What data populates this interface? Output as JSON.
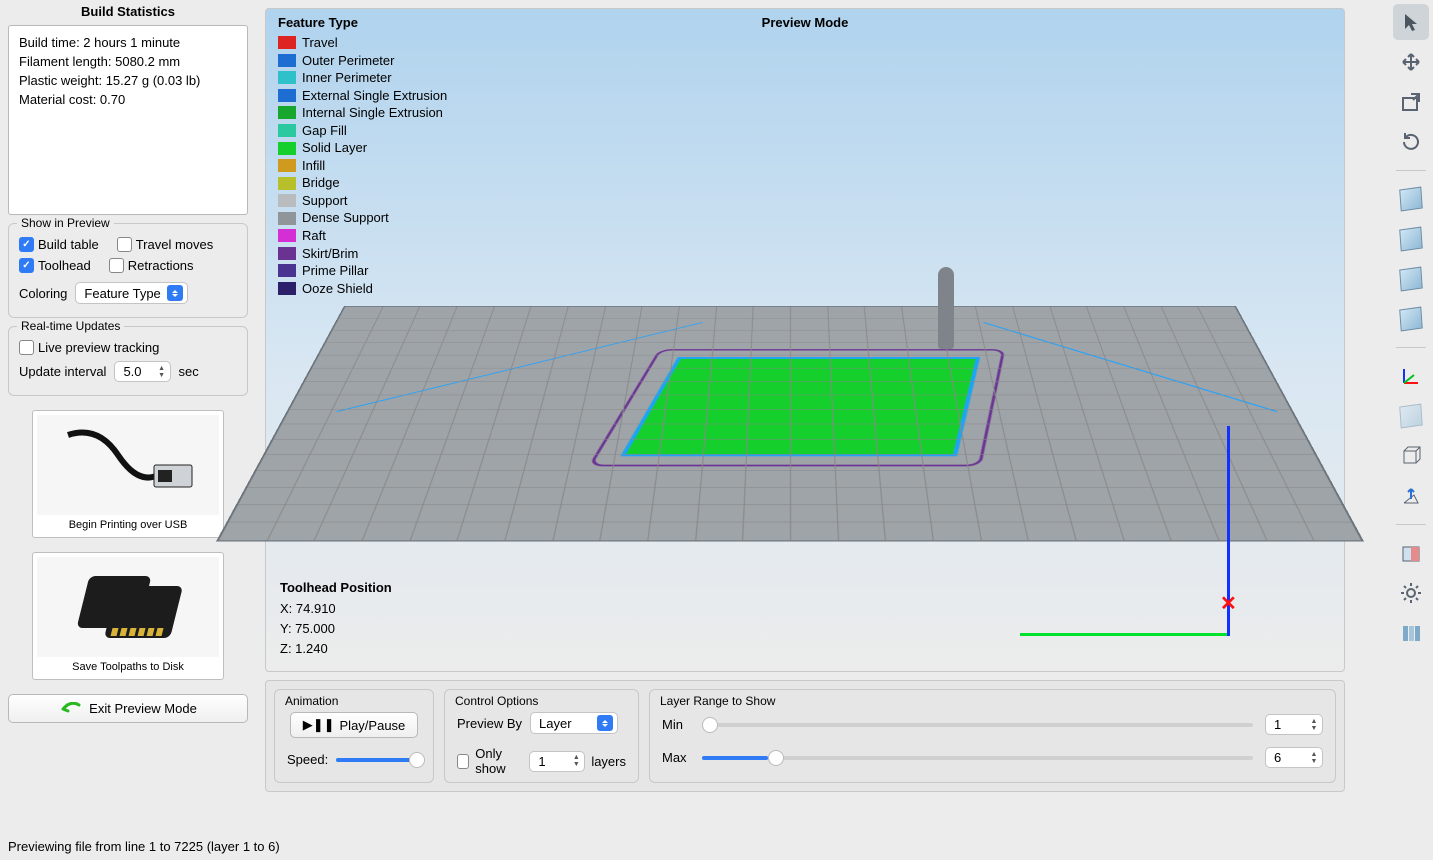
{
  "sidebar": {
    "title": "Build Statistics",
    "stats": {
      "build_time": "Build time: 2 hours 1 minute",
      "filament": "Filament length: 5080.2 mm",
      "weight": "Plastic weight: 15.27 g (0.03 lb)",
      "cost": "Material cost: 0.70"
    },
    "show_in_preview_title": "Show in Preview",
    "chk_build_table": "Build table",
    "chk_travel": "Travel moves",
    "chk_toolhead": "Toolhead",
    "chk_retract": "Retractions",
    "coloring_label": "Coloring",
    "coloring_value": "Feature Type",
    "realtime_title": "Real-time Updates",
    "chk_live": "Live preview tracking",
    "update_label": "Update interval",
    "update_value": "5.0",
    "update_unit": "sec",
    "card_usb": "Begin Printing over USB",
    "card_disk": "Save Toolpaths to Disk",
    "exit": "Exit Preview Mode"
  },
  "viewport": {
    "preview_mode": "Preview Mode",
    "legend_title": "Feature Type",
    "legend": [
      {
        "c": "#de2323",
        "t": "Travel"
      },
      {
        "c": "#1d6dd2",
        "t": "Outer Perimeter"
      },
      {
        "c": "#2fc1c9",
        "t": "Inner Perimeter"
      },
      {
        "c": "#1d6dd2",
        "t": "External Single Extrusion"
      },
      {
        "c": "#17a72f",
        "t": "Internal Single Extrusion"
      },
      {
        "c": "#2ac9a0",
        "t": "Gap Fill"
      },
      {
        "c": "#15cf2c",
        "t": "Solid Layer"
      },
      {
        "c": "#cf9a1d",
        "t": "Infill"
      },
      {
        "c": "#b7bf2b",
        "t": "Bridge"
      },
      {
        "c": "#b8bcbf",
        "t": "Support"
      },
      {
        "c": "#8f9599",
        "t": "Dense Support"
      },
      {
        "c": "#d42fd4",
        "t": "Raft"
      },
      {
        "c": "#6a3392",
        "t": "Skirt/Brim"
      },
      {
        "c": "#4b3392",
        "t": "Prime Pillar"
      },
      {
        "c": "#2d206b",
        "t": "Ooze Shield"
      }
    ],
    "toolpos_title": "Toolhead Position",
    "tx": "X: 74.910",
    "ty": "Y: 75.000",
    "tz": "Z: 1.240"
  },
  "bottom": {
    "anim_title": "Animation",
    "play": "Play/Pause",
    "speed": "Speed:",
    "ctrl_title": "Control Options",
    "preview_by": "Preview By",
    "preview_val": "Layer",
    "only_show": "Only show",
    "only_val": "1",
    "only_suf": "layers",
    "range_title": "Layer Range to Show",
    "min": "Min",
    "min_val": "1",
    "max": "Max",
    "max_val": "6"
  },
  "status": "Previewing file from line 1 to 7225 (layer 1 to 6)"
}
